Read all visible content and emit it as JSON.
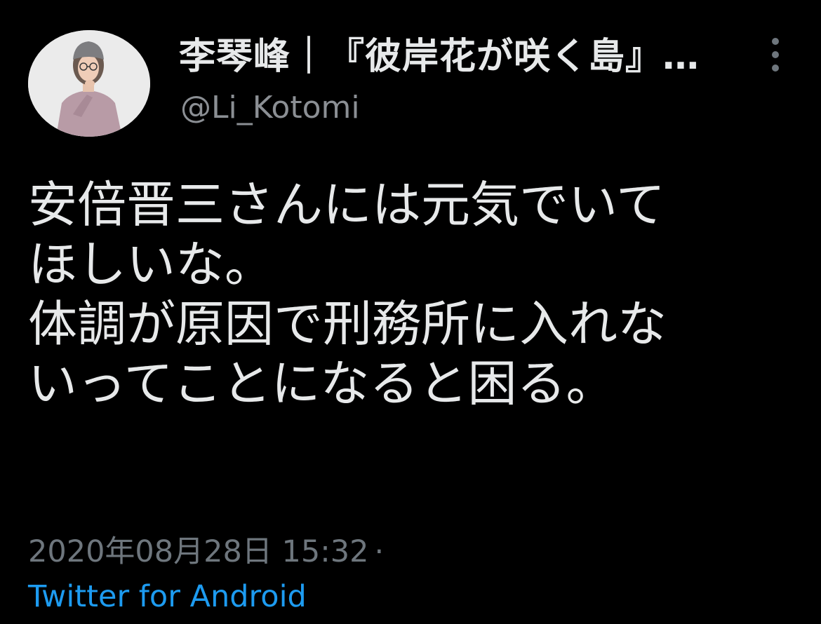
{
  "colors": {
    "background": "#000000",
    "text_primary": "#e7e9ea",
    "text_secondary": "#6e767d",
    "link": "#1d9bf0"
  },
  "author": {
    "display_name": "李琴峰｜『彼岸花が咲く島』…",
    "handle": "@Li_Kotomi",
    "avatar_icon": "profile-photo"
  },
  "tweet": {
    "lines": [
      "安倍晋三さんには元気でいて",
      "ほしいな。",
      "体調が原因で刑務所に入れな",
      "いってことになると困る。"
    ]
  },
  "meta": {
    "timestamp": "2020年08月28日 15:32",
    "separator": "·",
    "source": "Twitter for Android"
  },
  "menu": {
    "icon": "more-vertical-icon"
  }
}
